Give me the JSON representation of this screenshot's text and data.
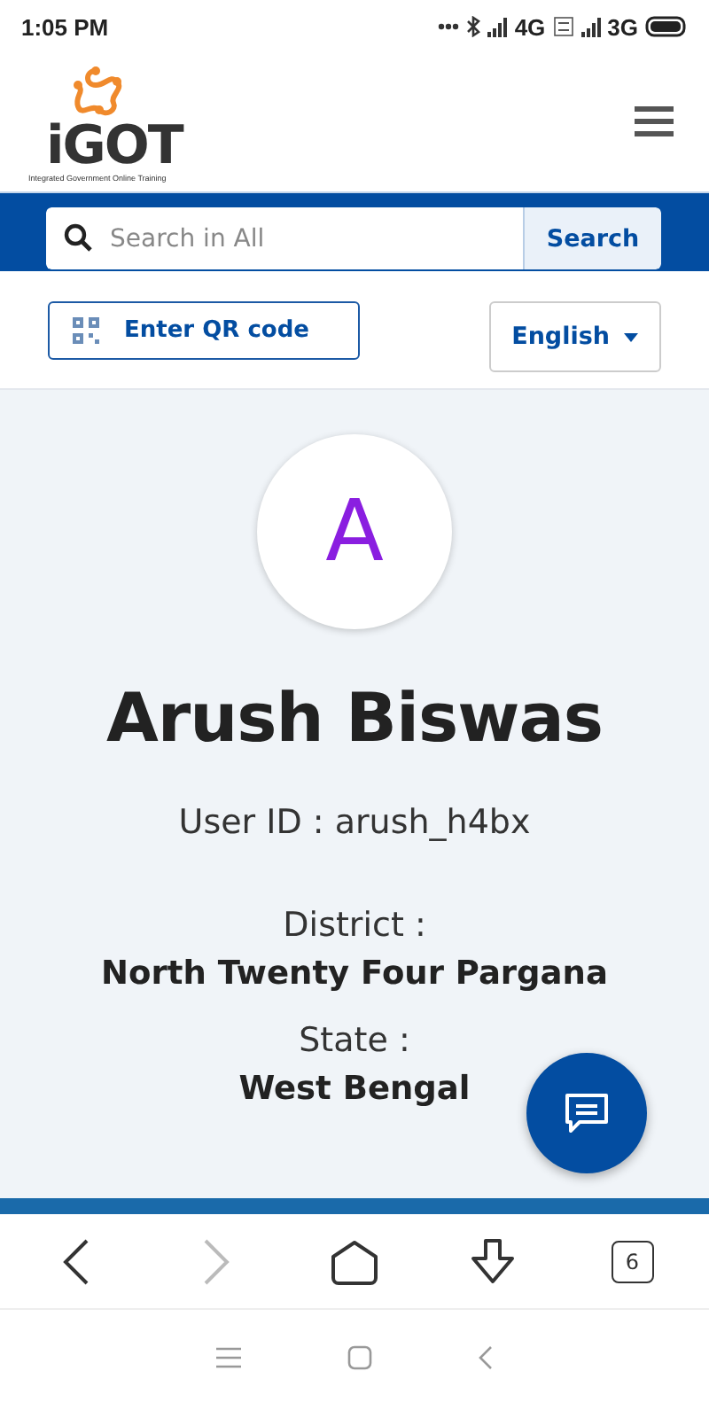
{
  "status_bar": {
    "time": "1:05 PM",
    "network_1": "4G",
    "network_2": "3G"
  },
  "header": {
    "logo_text": "iGOT",
    "logo_tagline": "Integrated Government Online Training"
  },
  "search": {
    "placeholder": "Search in All",
    "button": "Search"
  },
  "qr_button": {
    "label": "Enter QR code"
  },
  "language": {
    "value": "English"
  },
  "profile": {
    "initial": "A",
    "name": "Arush Biswas",
    "user_id": "User ID : arush_h4bx",
    "fields": [
      {
        "label": "District :",
        "value": "North Twenty Four Pargana"
      },
      {
        "label": "State :",
        "value": "West Bengal"
      }
    ]
  },
  "browser_nav": [
    {
      "kind": "back",
      "disabled": false
    },
    {
      "kind": "forward",
      "disabled": true
    },
    {
      "kind": "home",
      "disabled": false
    },
    {
      "kind": "download",
      "disabled": false
    },
    {
      "kind": "tabs",
      "disabled": false,
      "count": "6"
    }
  ]
}
